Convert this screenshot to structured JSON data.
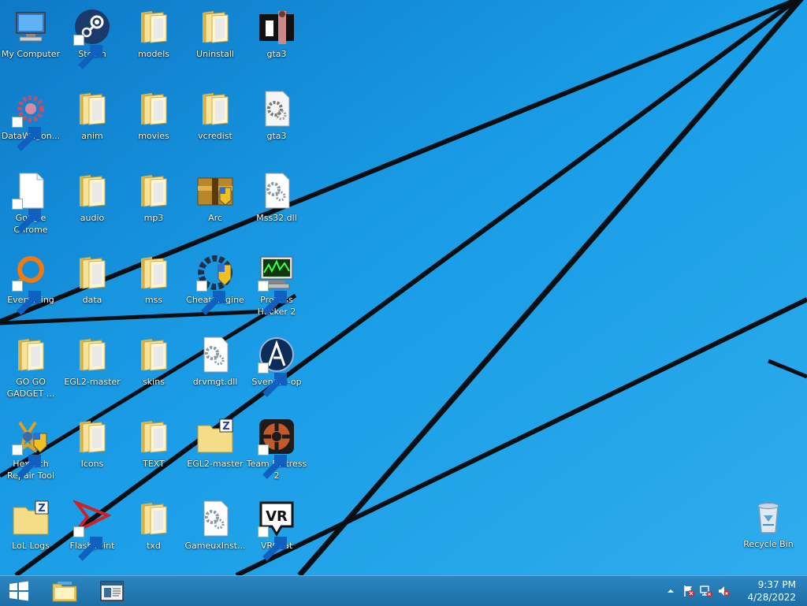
{
  "desktop": {
    "icons": [
      {
        "label": "My Computer",
        "icon": "computer-icon",
        "shortcut": false
      },
      {
        "label": "Steam",
        "icon": "steam-icon",
        "shortcut": true
      },
      {
        "label": "models",
        "icon": "folder-icon",
        "shortcut": false
      },
      {
        "label": "Uninstall",
        "icon": "folder-icon",
        "shortcut": false
      },
      {
        "label": "gta3",
        "icon": "gta3-exe-icon",
        "shortcut": false
      },
      {
        "label": "DataWagon...",
        "icon": "datawagon-icon",
        "shortcut": true
      },
      {
        "label": "anim",
        "icon": "folder-icon",
        "shortcut": false
      },
      {
        "label": "movies",
        "icon": "folder-icon",
        "shortcut": false
      },
      {
        "label": "vcredist",
        "icon": "folder-icon",
        "shortcut": false
      },
      {
        "label": "gta3",
        "icon": "config-file-icon",
        "shortcut": false
      },
      {
        "label": "Google Chrome",
        "icon": "blank-file-icon",
        "shortcut": true
      },
      {
        "label": "audio",
        "icon": "folder-icon",
        "shortcut": false
      },
      {
        "label": "mp3",
        "icon": "folder-icon",
        "shortcut": false
      },
      {
        "label": "Arc",
        "icon": "archive-icon",
        "shortcut": false
      },
      {
        "label": "Mss32.dll",
        "icon": "dll-file-icon",
        "shortcut": false
      },
      {
        "label": "Everything",
        "icon": "everything-icon",
        "shortcut": true
      },
      {
        "label": "data",
        "icon": "folder-icon",
        "shortcut": false
      },
      {
        "label": "mss",
        "icon": "folder-icon",
        "shortcut": false
      },
      {
        "label": "Cheat Engine",
        "icon": "cheat-engine-icon",
        "shortcut": true
      },
      {
        "label": "Process Hacker 2",
        "icon": "process-hacker-icon",
        "shortcut": true
      },
      {
        "label": "GO GO GADGET ...",
        "icon": "folder-icon",
        "shortcut": false
      },
      {
        "label": "EGL2-master",
        "icon": "folder-icon",
        "shortcut": false
      },
      {
        "label": "skins",
        "icon": "folder-icon",
        "shortcut": false
      },
      {
        "label": "drvmgt.dll",
        "icon": "dll-file-icon",
        "shortcut": false
      },
      {
        "label": "Sven Co-op",
        "icon": "sven-coop-icon",
        "shortcut": true
      },
      {
        "label": "Hextech Repair Tool",
        "icon": "hextech-icon",
        "shortcut": true
      },
      {
        "label": "Icons",
        "icon": "folder-icon",
        "shortcut": false
      },
      {
        "label": "TEXT",
        "icon": "folder-icon",
        "shortcut": false
      },
      {
        "label": "EGL2-master",
        "icon": "zip-folder-icon",
        "shortcut": false
      },
      {
        "label": "Team Fortress 2",
        "icon": "tf2-icon",
        "shortcut": true
      },
      {
        "label": "LoL Logs",
        "icon": "zip-folder-icon",
        "shortcut": false
      },
      {
        "label": "Flashpoint",
        "icon": "flashpoint-icon",
        "shortcut": true
      },
      {
        "label": "txd",
        "icon": "folder-icon",
        "shortcut": false
      },
      {
        "label": "GameuxInst...",
        "icon": "dll-file-icon",
        "shortcut": false
      },
      {
        "label": "VRChat",
        "icon": "vrchat-icon",
        "shortcut": true
      }
    ],
    "recycle_bin": {
      "label": "Recycle Bin",
      "icon": "recycle-bin-icon"
    }
  },
  "taskbar": {
    "start": {
      "icon": "windows-logo-icon"
    },
    "pinned": [
      {
        "name": "file-explorer",
        "icon": "file-explorer-icon"
      },
      {
        "name": "app-window",
        "icon": "app-window-icon"
      }
    ],
    "tray": {
      "icons": [
        "show-hidden-icons-chevron-icon",
        "action-center-flag-icon",
        "network-icon",
        "volume-muted-icon"
      ],
      "time": "9:37 PM",
      "date": "4/28/2022"
    }
  },
  "colors": {
    "desktop_bg": "#1fa3ea",
    "taskbar": "#1c6fa6"
  }
}
